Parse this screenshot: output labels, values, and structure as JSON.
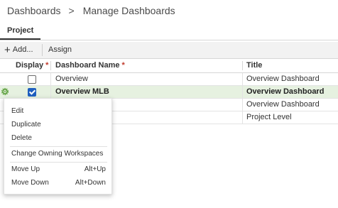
{
  "breadcrumb": {
    "root": "Dashboards",
    "separator": ">",
    "current": "Manage Dashboards"
  },
  "tabs": [
    {
      "label": "Project"
    }
  ],
  "toolbar": {
    "add_label": "Add...",
    "assign_label": "Assign"
  },
  "grid": {
    "columns": {
      "display": "Display",
      "name": "Dashboard Name",
      "title": "Title",
      "required_marker": "*"
    },
    "rows": [
      {
        "display": false,
        "name": "Overview",
        "title": "Overview Dashboard",
        "selected": false
      },
      {
        "display": true,
        "name": "Overview MLB",
        "title": "Overview Dashboard",
        "selected": true
      },
      {
        "display": false,
        "name": "",
        "title": "Overview Dashboard",
        "selected": false
      },
      {
        "display": false,
        "name": "",
        "title": "Project Level",
        "selected": false
      }
    ]
  },
  "context_menu": {
    "items": [
      {
        "label": "Edit",
        "shortcut": ""
      },
      {
        "label": "Duplicate",
        "shortcut": ""
      },
      {
        "label": "Delete",
        "shortcut": ""
      },
      {
        "label": "Change Owning Workspaces",
        "shortcut": ""
      },
      {
        "label": "Move Up",
        "shortcut": "Alt+Up"
      },
      {
        "label": "Move Down",
        "shortcut": "Alt+Down"
      }
    ]
  },
  "colors": {
    "selected_row": "#e6f1e0",
    "checkbox_on": "#1f5fbf",
    "required": "#c0392b",
    "gear": "#5a9e3a"
  },
  "icons": {
    "add": "plus-icon",
    "gear": "gear-icon",
    "separator": "chevron-right-icon"
  }
}
